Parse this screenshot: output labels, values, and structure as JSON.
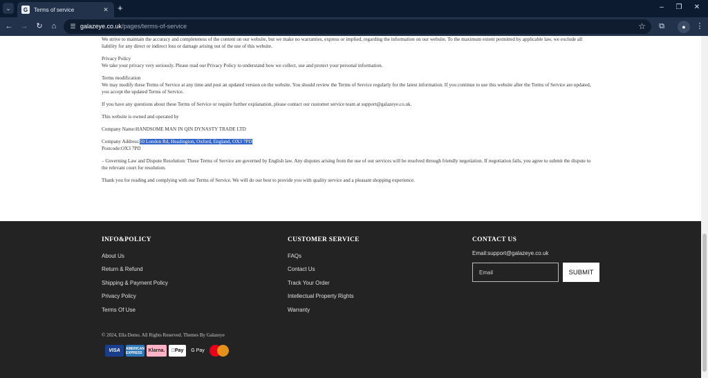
{
  "browser": {
    "tab_title": "Terms of service",
    "tab_favicon": "G",
    "tab_close": "✕",
    "new_tab": "+",
    "url_host": "galazeye.co.uk",
    "url_path": "/pages/terms-of-service",
    "window_controls": {
      "minimize": "–",
      "restore": "❐",
      "close": "✕"
    }
  },
  "terms": {
    "accuracy": "We strive to maintain the accuracy and completeness of the content on our website, but we make no warranties, express or implied, regarding the information on our website. To the maximum extent permitted by applicable law, we exclude all liability for any direct or indirect loss or damage arising out of the use of this website.",
    "privacy_heading": "Privacy Policy",
    "privacy_text": "We take your privacy very seriously. Please read our Privacy Policy to understand how we collect, use and protect your personal information.",
    "mod_heading": "Terms modification",
    "mod_text": "We may modify these Terms of Service at any time and post an updated version on the website. You should review the Terms of Service regularly for the latest information. If you continue to use this website after the Terms of Service are updated, you accept the updated Terms of Service.",
    "questions": "If you have any questions about these Terms of Service or require further explanation, please contact our customer service team at support@galazeye.co.uk.",
    "owned": "This website is owned and operated by",
    "company_name": "Company Name:HANDSOME MAN IN QIN DYNASTY TRADE LTD",
    "address_label": "Company Address:",
    "address_selected": "50 London Rd, Headington, Oxford, England, OX3 7PD",
    "postcode": "Postcode:OX3 7PD",
    "governing": "– Governing Law and Dispute Resolution: These Terms of Service are governed by English law. Any disputes arising from the use of our services will be resolved through friendly negotiation. If negotiation fails, you agree to submit the dispute to the relevant court for resolution.",
    "thanks": "Thank you for reading and complying with our Terms of Service. We will do our best to provide you with quality service and a pleasant shopping experience."
  },
  "footer": {
    "info_heading": "INFO&POLICY",
    "info_links": [
      "About Us",
      "Return & Refund",
      "Shipping & Payment Policy",
      "Privacy Policy",
      "Terms Of Use"
    ],
    "service_heading": "CUSTOMER SERVICE",
    "service_links": [
      "FAQs",
      "Contact Us",
      "Track Your Order",
      "Intellectual Property Rights",
      "Warranty"
    ],
    "contact_heading": "CONTACT US",
    "contact_email": "Email:support@galazeye.co.uk",
    "email_placeholder": "Email",
    "submit_label": "SUBMIT",
    "copyright": "© 2024, Ella Demo. All Rights Reserved. Themes By Galazeye",
    "payments": {
      "visa": "VISA",
      "amex": "AMERICAN EXPRESS",
      "klarna": "Klarna.",
      "apple_pay": "Pay",
      "google_pay": "G Pay"
    }
  }
}
